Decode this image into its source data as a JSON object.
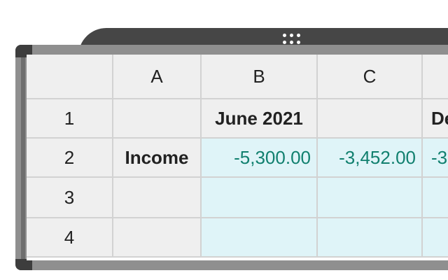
{
  "columns": [
    "",
    "A",
    "B",
    "C",
    ""
  ],
  "rows": [
    {
      "header": "1",
      "cells": [
        "",
        "June 2021",
        "",
        "De"
      ]
    },
    {
      "header": "2",
      "cells": [
        "Income",
        "-5,300.00",
        "-3,452.00",
        "-3"
      ]
    },
    {
      "header": "3",
      "cells": [
        "",
        "",
        "",
        ""
      ]
    },
    {
      "header": "4",
      "cells": [
        "",
        "",
        "",
        ""
      ]
    }
  ],
  "colors": {
    "number_text": "#11806f",
    "selection_fill": "#dff4f8",
    "header_fill": "#efefef",
    "chrome_dark": "#464646"
  },
  "icons": {
    "drag_handle": "grip-dots-icon"
  }
}
